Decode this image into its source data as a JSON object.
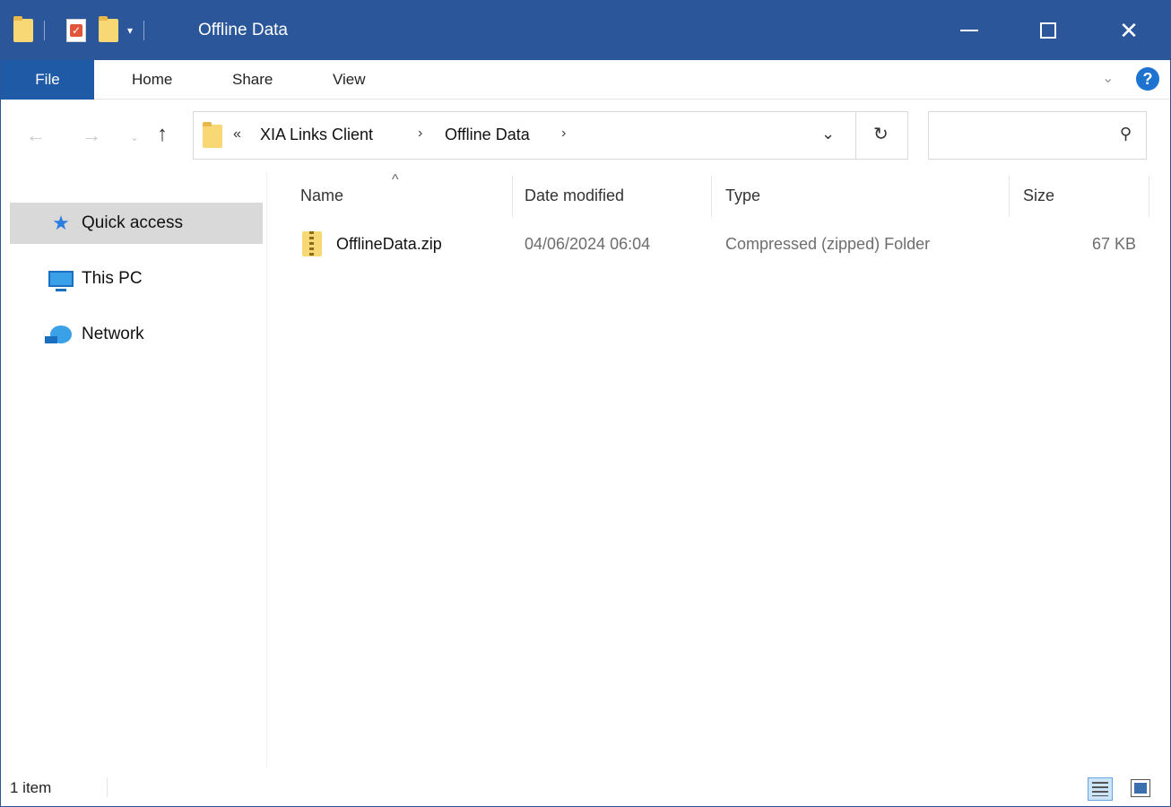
{
  "window": {
    "title": "Offline Data",
    "minimize_glyph": "",
    "maximize_glyph": "",
    "close_glyph": "✕"
  },
  "quick_access_toolbar": {
    "dropdown_glyph": "▾"
  },
  "ribbon": {
    "tabs": [
      "File",
      "Home",
      "Share",
      "View"
    ],
    "expand_glyph": "⌄",
    "help_glyph": "?"
  },
  "navigation": {
    "back_glyph": "←",
    "forward_glyph": "→",
    "recent_glyph": "⌄",
    "up_glyph": "↑",
    "overflow_glyph": "«",
    "breadcrumbs": [
      "XIA Links Client",
      "Offline Data"
    ],
    "separator_glyph": "›",
    "dropdown_glyph": "⌄",
    "refresh_glyph": "↻",
    "search_placeholder": "",
    "search_glyph": "⚲"
  },
  "nav_pane": {
    "items": [
      {
        "label": "Quick access",
        "icon": "quick-access-star-icon",
        "selected": true
      },
      {
        "label": "This PC",
        "icon": "this-pc-icon",
        "selected": false
      },
      {
        "label": "Network",
        "icon": "network-icon",
        "selected": false
      }
    ]
  },
  "file_list": {
    "sort_glyph": "^",
    "columns": [
      "Name",
      "Date modified",
      "Type",
      "Size"
    ],
    "rows": [
      {
        "name": "OfflineData.zip",
        "date_modified": "04/06/2024 06:04",
        "type": "Compressed (zipped) Folder",
        "size": "67 KB",
        "icon": "zip-folder-icon"
      }
    ]
  },
  "status_bar": {
    "item_count": "1 item"
  },
  "colors": {
    "title_bar": "#2b579a",
    "file_tab": "#1e5aa6",
    "selected_nav": "#d9d9d9",
    "folder": "#f8d775"
  }
}
